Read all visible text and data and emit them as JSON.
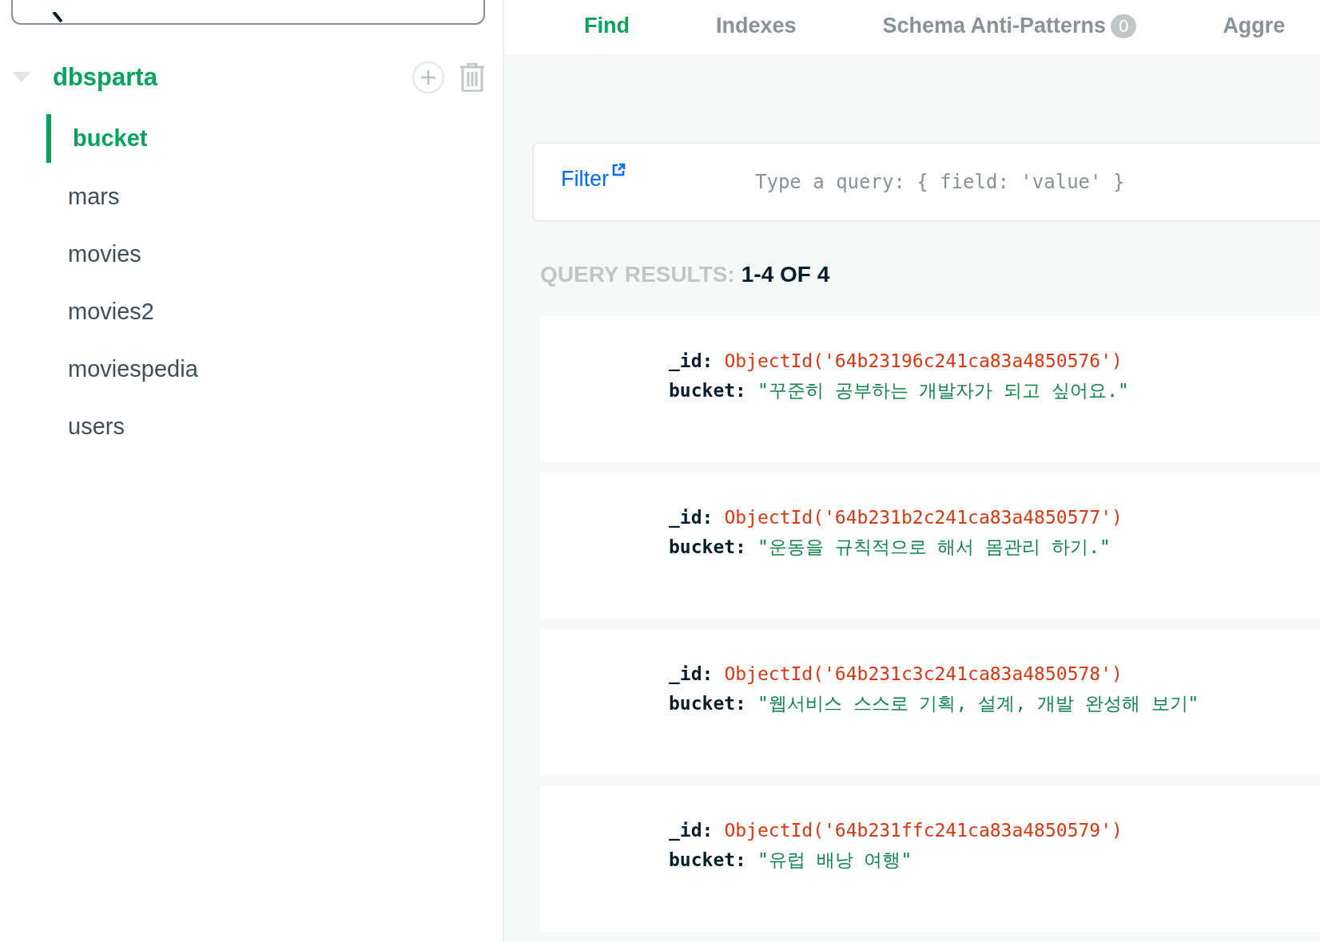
{
  "sidebar": {
    "database": {
      "name": "dbsparta",
      "expanded": true
    },
    "collections": [
      {
        "name": "bucket",
        "selected": true
      },
      {
        "name": "mars",
        "selected": false
      },
      {
        "name": "movies",
        "selected": false
      },
      {
        "name": "movies2",
        "selected": false
      },
      {
        "name": "moviespedia",
        "selected": false
      },
      {
        "name": "users",
        "selected": false
      }
    ]
  },
  "tabs": [
    {
      "label": "Find",
      "selected": true
    },
    {
      "label": "Indexes",
      "selected": false
    },
    {
      "label": "Schema Anti-Patterns",
      "selected": false,
      "badge": "0"
    },
    {
      "label": "Aggre",
      "selected": false
    }
  ],
  "filter": {
    "label": "Filter",
    "placeholder": "Type a query: { field: 'value' }"
  },
  "results": {
    "label": "QUERY RESULTS:",
    "count": "1-4 OF 4"
  },
  "documents": [
    {
      "fields": [
        {
          "key": "_id:",
          "value": "ObjectId('64b23196c241ca83a4850576')",
          "kind": "objectid"
        },
        {
          "key": "bucket:",
          "value": "\"꾸준히 공부하는 개발자가 되고 싶어요.\"",
          "kind": "string"
        }
      ]
    },
    {
      "fields": [
        {
          "key": "_id:",
          "value": "ObjectId('64b231b2c241ca83a4850577')",
          "kind": "objectid"
        },
        {
          "key": "bucket:",
          "value": "\"운동을 규칙적으로 해서 몸관리 하기.\"",
          "kind": "string"
        }
      ]
    },
    {
      "fields": [
        {
          "key": "_id:",
          "value": "ObjectId('64b231c3c241ca83a4850578')",
          "kind": "objectid"
        },
        {
          "key": "bucket:",
          "value": "\"웹서비스 스스로 기획, 설계, 개발 완성해 보기\"",
          "kind": "string"
        }
      ]
    },
    {
      "fields": [
        {
          "key": "_id:",
          "value": "ObjectId('64b231ffc241ca83a4850579')",
          "kind": "objectid"
        },
        {
          "key": "bucket:",
          "value": "\"유럽 배낭 여행\"",
          "kind": "string"
        }
      ]
    }
  ]
}
